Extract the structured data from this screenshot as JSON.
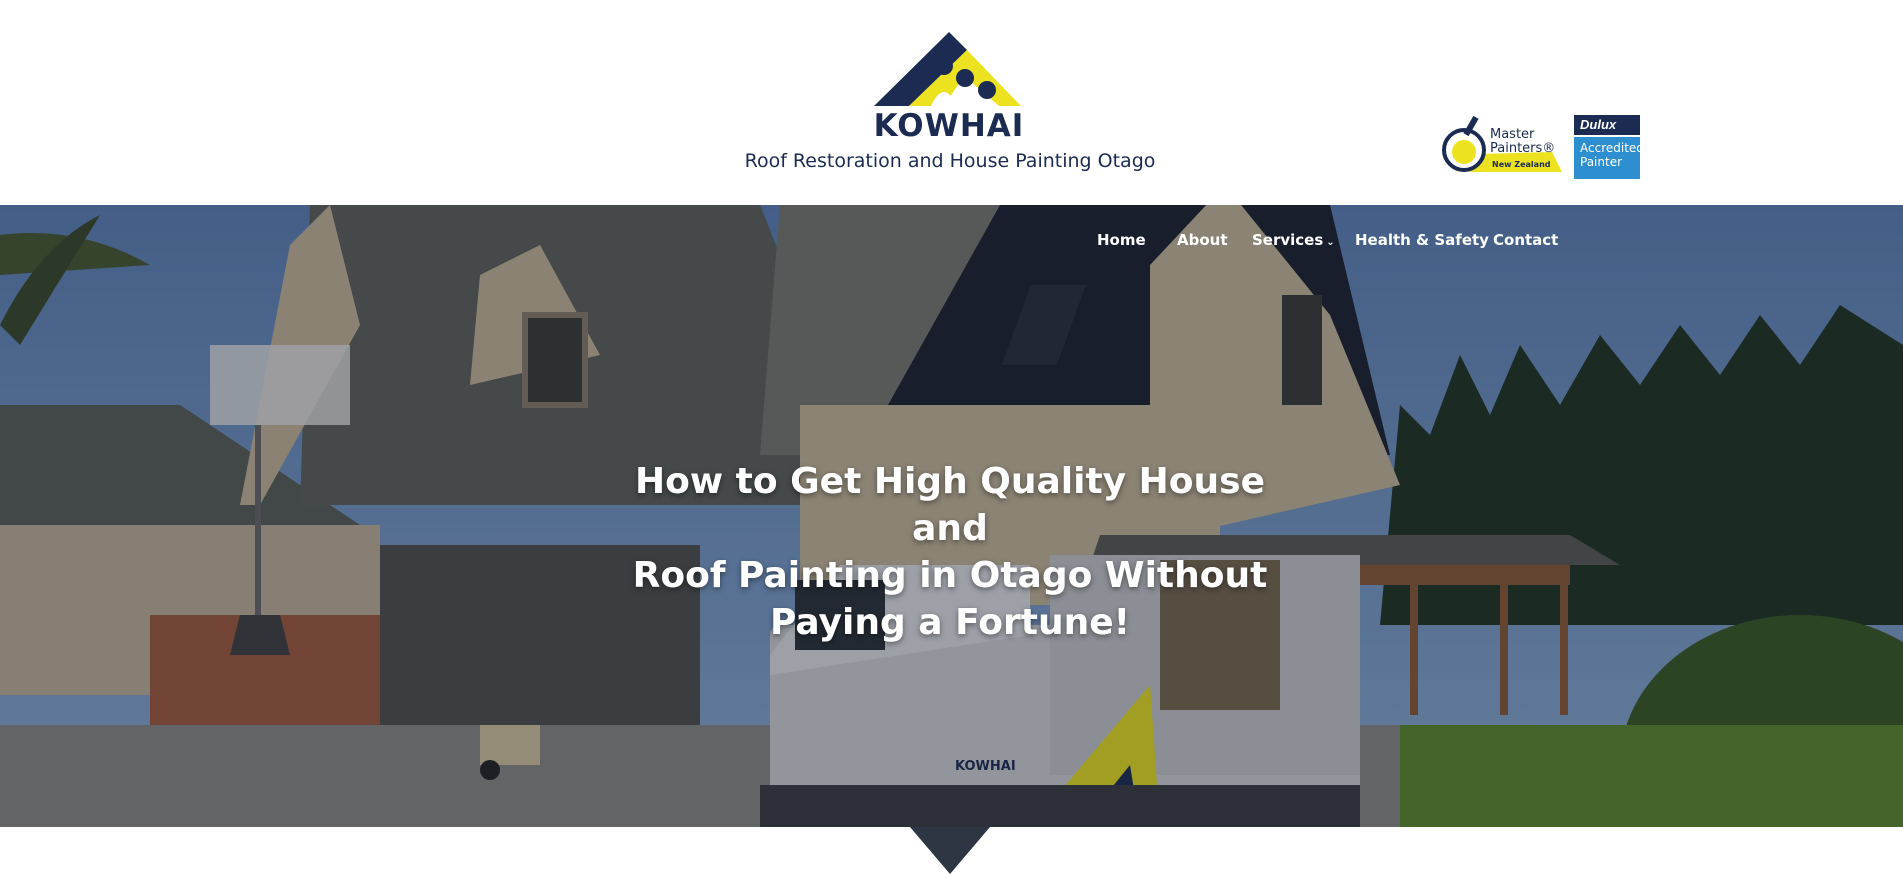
{
  "brand": {
    "name": "KOWHAI",
    "tagline": "Roof Restoration and House Painting Otago"
  },
  "badges": {
    "master_painters": {
      "line1": "Master",
      "line2": "Painters®",
      "line3": "New Zealand"
    },
    "dulux": {
      "brand": "Dulux",
      "line1": "Accredited",
      "line2": "Painter"
    }
  },
  "nav": {
    "items": [
      {
        "label": "Home"
      },
      {
        "label": "About"
      },
      {
        "label": "Services",
        "has_dropdown": true
      },
      {
        "label": "Health & Safety"
      },
      {
        "label": "Contact"
      }
    ]
  },
  "hero": {
    "headline_line1": "How to Get High Quality House and",
    "headline_line2": "Roof Painting in Otago Without",
    "headline_line3": "Paying a Fortune!",
    "van_logo_text": "KOWHAI"
  },
  "colors": {
    "navy": "#1b2b52",
    "yellow": "#ece220",
    "dulux_blue": "#2e8fd0",
    "sky": "#5d82b8"
  }
}
